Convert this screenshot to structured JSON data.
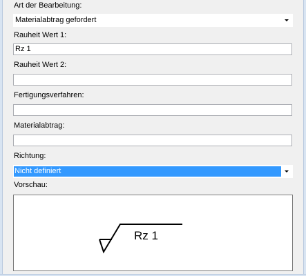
{
  "form": {
    "art_label": "Art der Bearbeitung:",
    "art_value": "Materialabtrag gefordert",
    "rauheit1_label": "Rauheit Wert 1:",
    "rauheit1_value": "Rz 1",
    "rauheit2_label": "Rauheit Wert 2:",
    "rauheit2_value": "",
    "fertigung_label": "Fertigungsverfahren:",
    "fertigung_value": "",
    "abtrag_label": "Materialabtrag:",
    "abtrag_value": "",
    "richtung_label": "Richtung:",
    "richtung_value": "Nicht definiert",
    "vorschau_label": "Vorschau:"
  },
  "preview": {
    "symbol_text": "Rz 1"
  },
  "colors": {
    "selection": "#3399ff",
    "window_bg": "#f0f0f0"
  }
}
